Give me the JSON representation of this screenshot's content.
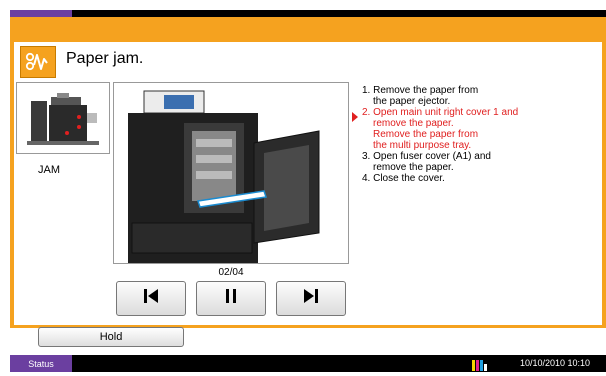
{
  "header": {
    "title": "Paper jam.",
    "icon": "paper-jam-icon",
    "accent_color": "#f5a21f",
    "tab_color": "#6b3fa0"
  },
  "thumbnail": {
    "label": "JAM"
  },
  "steps": [
    "1. Remove the paper from",
    "the paper ejector.",
    "2. Open main unit right cover 1 and",
    "remove the paper.",
    "Remove the paper from",
    "the multi purpose tray.",
    "3. Open fuser cover (A1) and",
    "remove the paper.",
    "4. Close the cover."
  ],
  "active_step_color": "#e02020",
  "pager": {
    "page": "02/04"
  },
  "controls": {
    "prev_icon": "skip-previous-icon",
    "pause_icon": "pause-icon",
    "next_icon": "skip-next-icon"
  },
  "footer": {
    "hold_label": "Hold",
    "status_label": "Status",
    "datetime": "10/10/2010  10:10"
  }
}
